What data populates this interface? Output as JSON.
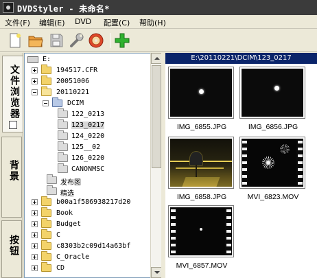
{
  "window": {
    "title": "DVDStyler - 未命名*"
  },
  "menubar": {
    "items": [
      {
        "label": "文件(F)"
      },
      {
        "label": "编辑(E)"
      },
      {
        "label": "DVD"
      },
      {
        "label": "配置(C)"
      },
      {
        "label": "帮助(H)"
      }
    ]
  },
  "toolbar": {
    "buttons": [
      {
        "icon": "new-document-icon"
      },
      {
        "icon": "open-folder-icon"
      },
      {
        "icon": "save-disabled-icon"
      },
      {
        "icon": "settings-wrench-icon"
      },
      {
        "icon": "burn-disc-icon"
      },
      {
        "icon": "add-plus-icon"
      }
    ]
  },
  "side_tabs": [
    {
      "label": "文件浏览器",
      "active": true
    },
    {
      "label": "背景",
      "active": false
    },
    {
      "label": "按钮",
      "active": false
    }
  ],
  "tree": {
    "rows": [
      {
        "label": "E:"
      },
      {
        "label": "194517.CFR"
      },
      {
        "label": "20051006"
      },
      {
        "label": "20110221"
      },
      {
        "label": "DCIM"
      },
      {
        "label": "122_0213"
      },
      {
        "label": "123_0217",
        "selected": true
      },
      {
        "label": "124_0220"
      },
      {
        "label": "125__02"
      },
      {
        "label": "126_0220"
      },
      {
        "label": "CANONMSC"
      },
      {
        "label": "发布图"
      },
      {
        "label": "精选"
      },
      {
        "label": "b00a1f586938217d20"
      },
      {
        "label": "Book"
      },
      {
        "label": "Budget"
      },
      {
        "label": "C"
      },
      {
        "label": "c8303b2c09d14a63bf"
      },
      {
        "label": "C_Oracle"
      },
      {
        "label": "CD"
      }
    ]
  },
  "gallery": {
    "path": "E:\\20110221\\DCIM\\123_0217",
    "items": [
      {
        "caption": "IMG_6855.JPG"
      },
      {
        "caption": "IMG_6856.JPG"
      },
      {
        "caption": "IMG_6858.JPG"
      },
      {
        "caption": "MVI_6823.MOV"
      },
      {
        "caption": "MVI_6857.MOV"
      }
    ]
  },
  "colors": {
    "titlebar_bg": "#3b3b3b",
    "path_bar_bg": "#0a246a",
    "window_bg": "#ece9d8"
  }
}
